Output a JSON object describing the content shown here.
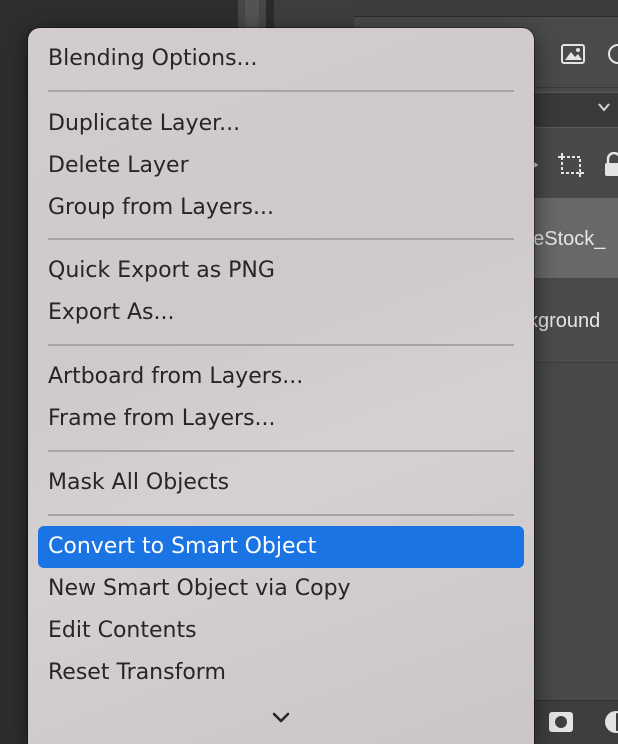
{
  "menu": {
    "items": [
      {
        "label": "Blending Options..."
      },
      {
        "label": "Duplicate Layer..."
      },
      {
        "label": "Delete Layer"
      },
      {
        "label": "Group from Layers..."
      },
      {
        "label": "Quick Export as PNG"
      },
      {
        "label": "Export As..."
      },
      {
        "label": "Artboard from Layers..."
      },
      {
        "label": "Frame from Layers..."
      },
      {
        "label": "Mask All Objects"
      },
      {
        "label": "Convert to Smart Object",
        "highlighted": true
      },
      {
        "label": "New Smart Object via Copy"
      },
      {
        "label": "Edit Contents"
      },
      {
        "label": "Reset Transform"
      }
    ],
    "highlight_color": "#1a74e4"
  },
  "background": {
    "layers": [
      {
        "label_fragment": "beStock_"
      },
      {
        "label_fragment": "kground"
      }
    ]
  },
  "icons": {
    "image": "image-icon",
    "chevron_down": "chevron-down-icon",
    "artboard": "artboard-icon",
    "lock": "lock-icon",
    "scroll_down": "chevron-down-icon"
  }
}
